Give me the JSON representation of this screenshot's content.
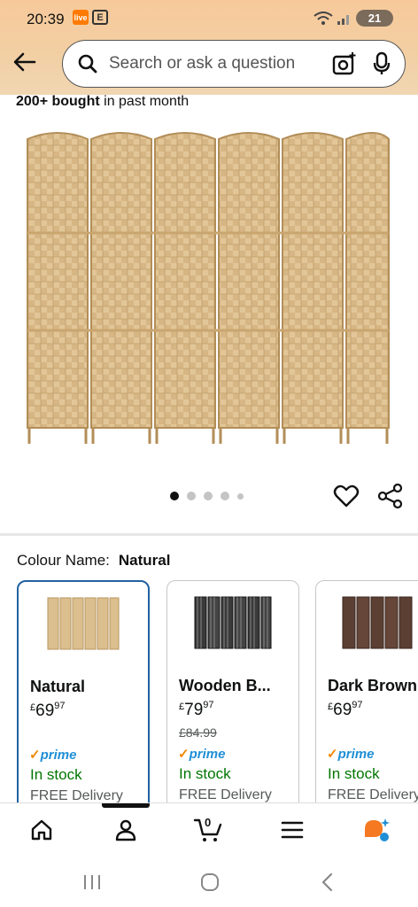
{
  "status_bar": {
    "time": "20:39",
    "battery": "21",
    "badge1": "live",
    "badge2": "E"
  },
  "header": {
    "search_placeholder": "Search or ask a question"
  },
  "product": {
    "bought_strong": "200+ bought",
    "bought_rest": " in past month",
    "image_count": 5,
    "active_image": 1
  },
  "colour": {
    "label": "Colour Name:",
    "selected": "Natural",
    "options": [
      {
        "name": "Natural",
        "currency": "£",
        "price_whole": "69",
        "price_frac": "97",
        "was": "",
        "prime": "prime",
        "stock": "In stock",
        "delivery": "FREE Delivery"
      },
      {
        "name": "Wooden B...",
        "currency": "£",
        "price_whole": "79",
        "price_frac": "97",
        "was": "£84.99",
        "prime": "prime",
        "stock": "In stock",
        "delivery": "FREE Delivery"
      },
      {
        "name": "Dark Brown",
        "currency": "£",
        "price_whole": "69",
        "price_frac": "97",
        "was": "",
        "prime": "prime",
        "stock": "In stock",
        "delivery": "FREE Delivery"
      }
    ]
  },
  "bottom_nav": {
    "cart_count": "0"
  },
  "colors": {
    "accent_blue": "#2162a1",
    "in_stock": "#007600",
    "prime_blue": "#1f8fd6",
    "header_bg": "#f7c99a"
  }
}
